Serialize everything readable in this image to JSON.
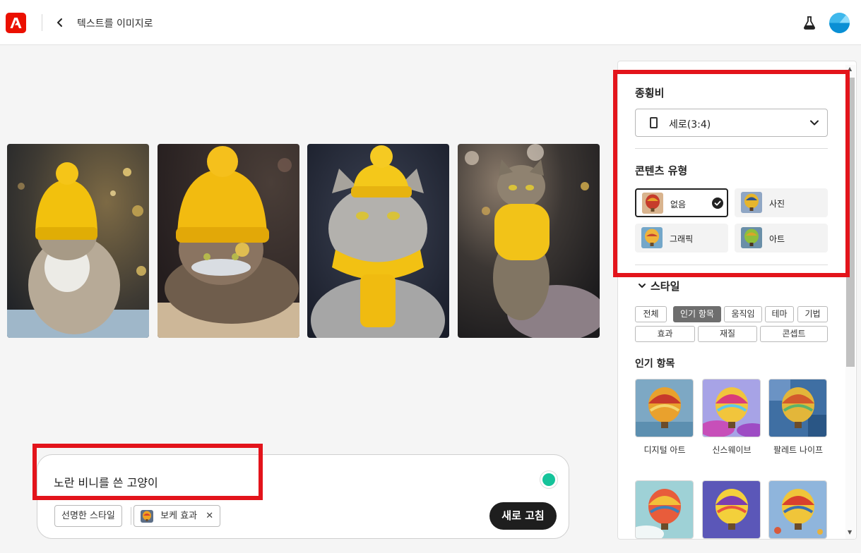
{
  "header": {
    "title": "텍스트를 이미지로",
    "brand_color": "#eb1000"
  },
  "gallery": {
    "images": [
      {
        "alt": "cat-1",
        "hat": "yellow beanie"
      },
      {
        "alt": "cat-2",
        "hat": "yellow beanie"
      },
      {
        "alt": "cat-3",
        "hat": "yellow beanie"
      },
      {
        "alt": "cat-4",
        "hat": "yellow scarf"
      }
    ]
  },
  "prompt": {
    "text": "노란 비니를 쓴 고양이",
    "chips": [
      {
        "label": "선명한 스타일"
      },
      {
        "label": "보케 효과",
        "removable": true
      }
    ],
    "refresh_label": "새로 고침"
  },
  "panel": {
    "aspect": {
      "title": "종횡비",
      "value": "세로(3:4)"
    },
    "content_type": {
      "title": "콘텐츠 유형",
      "options": [
        {
          "label": "없음",
          "selected": true
        },
        {
          "label": "사진",
          "selected": false
        },
        {
          "label": "그래픽",
          "selected": false
        },
        {
          "label": "아트",
          "selected": false
        }
      ]
    },
    "style": {
      "title": "스타일",
      "tags": [
        "전체",
        "인기 항목",
        "움직임",
        "테마",
        "기법",
        "효과",
        "재질",
        "콘셉트"
      ],
      "active_tag": "인기 항목",
      "section_title": "인기 항목",
      "thumbs": [
        {
          "label": "디지털 아트"
        },
        {
          "label": "신스웨이브"
        },
        {
          "label": "팔레트 나이프"
        },
        {
          "label": ""
        },
        {
          "label": ""
        },
        {
          "label": ""
        }
      ]
    }
  },
  "colors": {
    "highlight": "#e3141b",
    "refresh_bg": "#1e1e1e",
    "active_tag_bg": "#6e6e6e"
  }
}
